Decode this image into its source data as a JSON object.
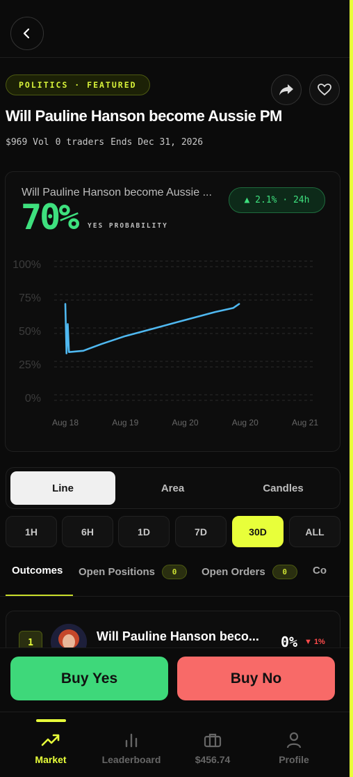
{
  "header": {
    "category_tag": "POLITICS · FEATURED",
    "title": "Will Pauline Hanson become Aussie PM",
    "meta": {
      "volume": "$969 Vol",
      "traders": "0 traders",
      "ends": "Ends Dec 31, 2026"
    }
  },
  "chart_card": {
    "title": "Will Pauline Hanson become Aussie ...",
    "probability": "70%",
    "probability_label": "YES PROBABILITY",
    "change": "▲ 2.1% · 24h"
  },
  "chart_data": {
    "type": "line",
    "x_labels": [
      "Aug 18",
      "Aug 19",
      "Aug 20",
      "Aug 20",
      "Aug 21"
    ],
    "y_tick_labels": [
      "100%",
      "75%",
      "50%",
      "25%",
      "0%"
    ],
    "ylim": [
      0,
      100
    ],
    "grid": true,
    "series": [
      {
        "color": "#4fb8f0",
        "points": [
          {
            "x": 0.0,
            "y": 70
          },
          {
            "x": 0.02,
            "y": 33
          },
          {
            "x": 0.04,
            "y": 55
          },
          {
            "x": 0.06,
            "y": 34
          },
          {
            "x": 0.3,
            "y": 35
          },
          {
            "x": 0.6,
            "y": 40
          },
          {
            "x": 1.0,
            "y": 46
          },
          {
            "x": 1.5,
            "y": 52
          },
          {
            "x": 2.0,
            "y": 58
          },
          {
            "x": 2.5,
            "y": 64
          },
          {
            "x": 2.8,
            "y": 67
          },
          {
            "x": 2.9,
            "y": 70
          }
        ]
      }
    ]
  },
  "chart_types": [
    "Line",
    "Area",
    "Candles"
  ],
  "timeframes": [
    "1H",
    "6H",
    "1D",
    "7D",
    "30D",
    "ALL"
  ],
  "tabs": {
    "outcomes": "Outcomes",
    "open_positions": "Open Positions",
    "open_positions_count": "0",
    "open_orders": "Open Orders",
    "open_orders_count": "0",
    "more": "Co"
  },
  "outcome": {
    "rank": "1",
    "name": "Will Pauline Hanson beco...",
    "percent": "0%",
    "change": "▼ 1%"
  },
  "actions": {
    "buy_yes": "Buy Yes",
    "buy_no": "Buy No"
  },
  "nav": {
    "market": "Market",
    "leaderboard": "Leaderboard",
    "portfolio": "$456.74",
    "profile": "Profile"
  },
  "colors": {
    "accent": "#e8ff3a",
    "yes": "#3ed87a",
    "no": "#f86a68",
    "line": "#4fb8f0"
  }
}
